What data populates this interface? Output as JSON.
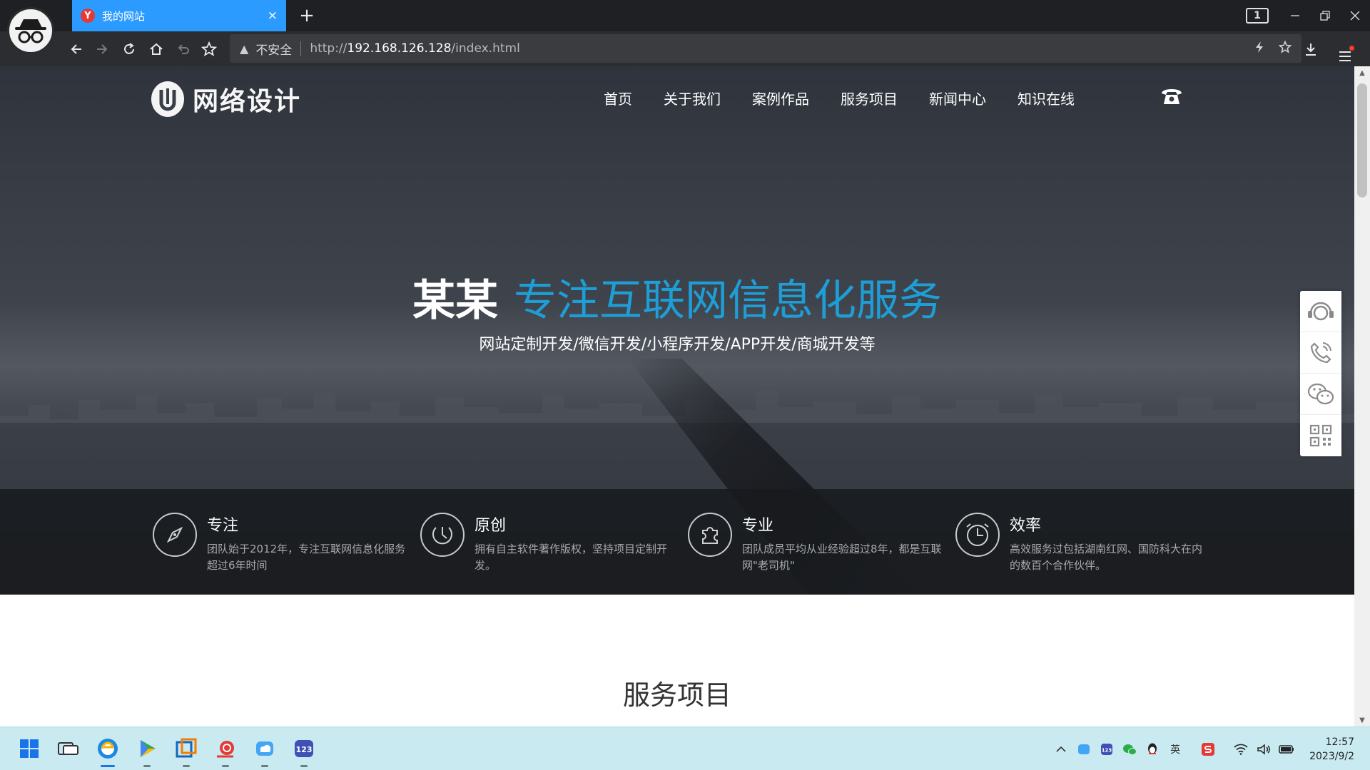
{
  "browser": {
    "tab": {
      "favicon_letter": "Y",
      "title": "我的网站",
      "close_label": "×"
    },
    "new_tab_label": "+",
    "tab_count": "1",
    "address": {
      "security_label": "不安全",
      "url_prefix": "http://",
      "url_host": "192.168.126.128",
      "url_path": "/index.html"
    }
  },
  "site": {
    "logo_text": "网络设计",
    "nav": [
      {
        "label": "首页"
      },
      {
        "label": "关于我们"
      },
      {
        "label": "案例作品"
      },
      {
        "label": "服务项目"
      },
      {
        "label": "新闻中心"
      },
      {
        "label": "知识在线"
      }
    ],
    "hero": {
      "brand": "某某",
      "title": "专注互联网信息化服务",
      "subtitle": "网站定制开发/微信开发/小程序开发/APP开发/商城开发等"
    },
    "features": [
      {
        "title": "专注",
        "desc": "团队始于2012年，专注互联网信息化服务超过6年时间",
        "icon": "compass-icon"
      },
      {
        "title": "原创",
        "desc": "拥有自主软件著作版权，坚持项目定制开发。",
        "icon": "dial-icon"
      },
      {
        "title": "专业",
        "desc": "团队成员平均从业经验超过8年，都是互联网\"老司机\"",
        "icon": "puzzle-icon"
      },
      {
        "title": "效率",
        "desc": "高效服务过包括湖南红网、国防科大在内的数百个合作伙伴。",
        "icon": "clock-icon"
      }
    ],
    "section_title": "服务项目",
    "side_tools": [
      "headset-icon",
      "phone-icon",
      "wechat-icon",
      "qrcode-icon"
    ]
  },
  "taskbar": {
    "clock_time": "12:57",
    "clock_date": "2023/9/2",
    "tray_ime": "英"
  },
  "colors": {
    "accent": "#1e9ed6",
    "tab_active": "#2c9bff",
    "taskbar": "#c8eaf0"
  }
}
